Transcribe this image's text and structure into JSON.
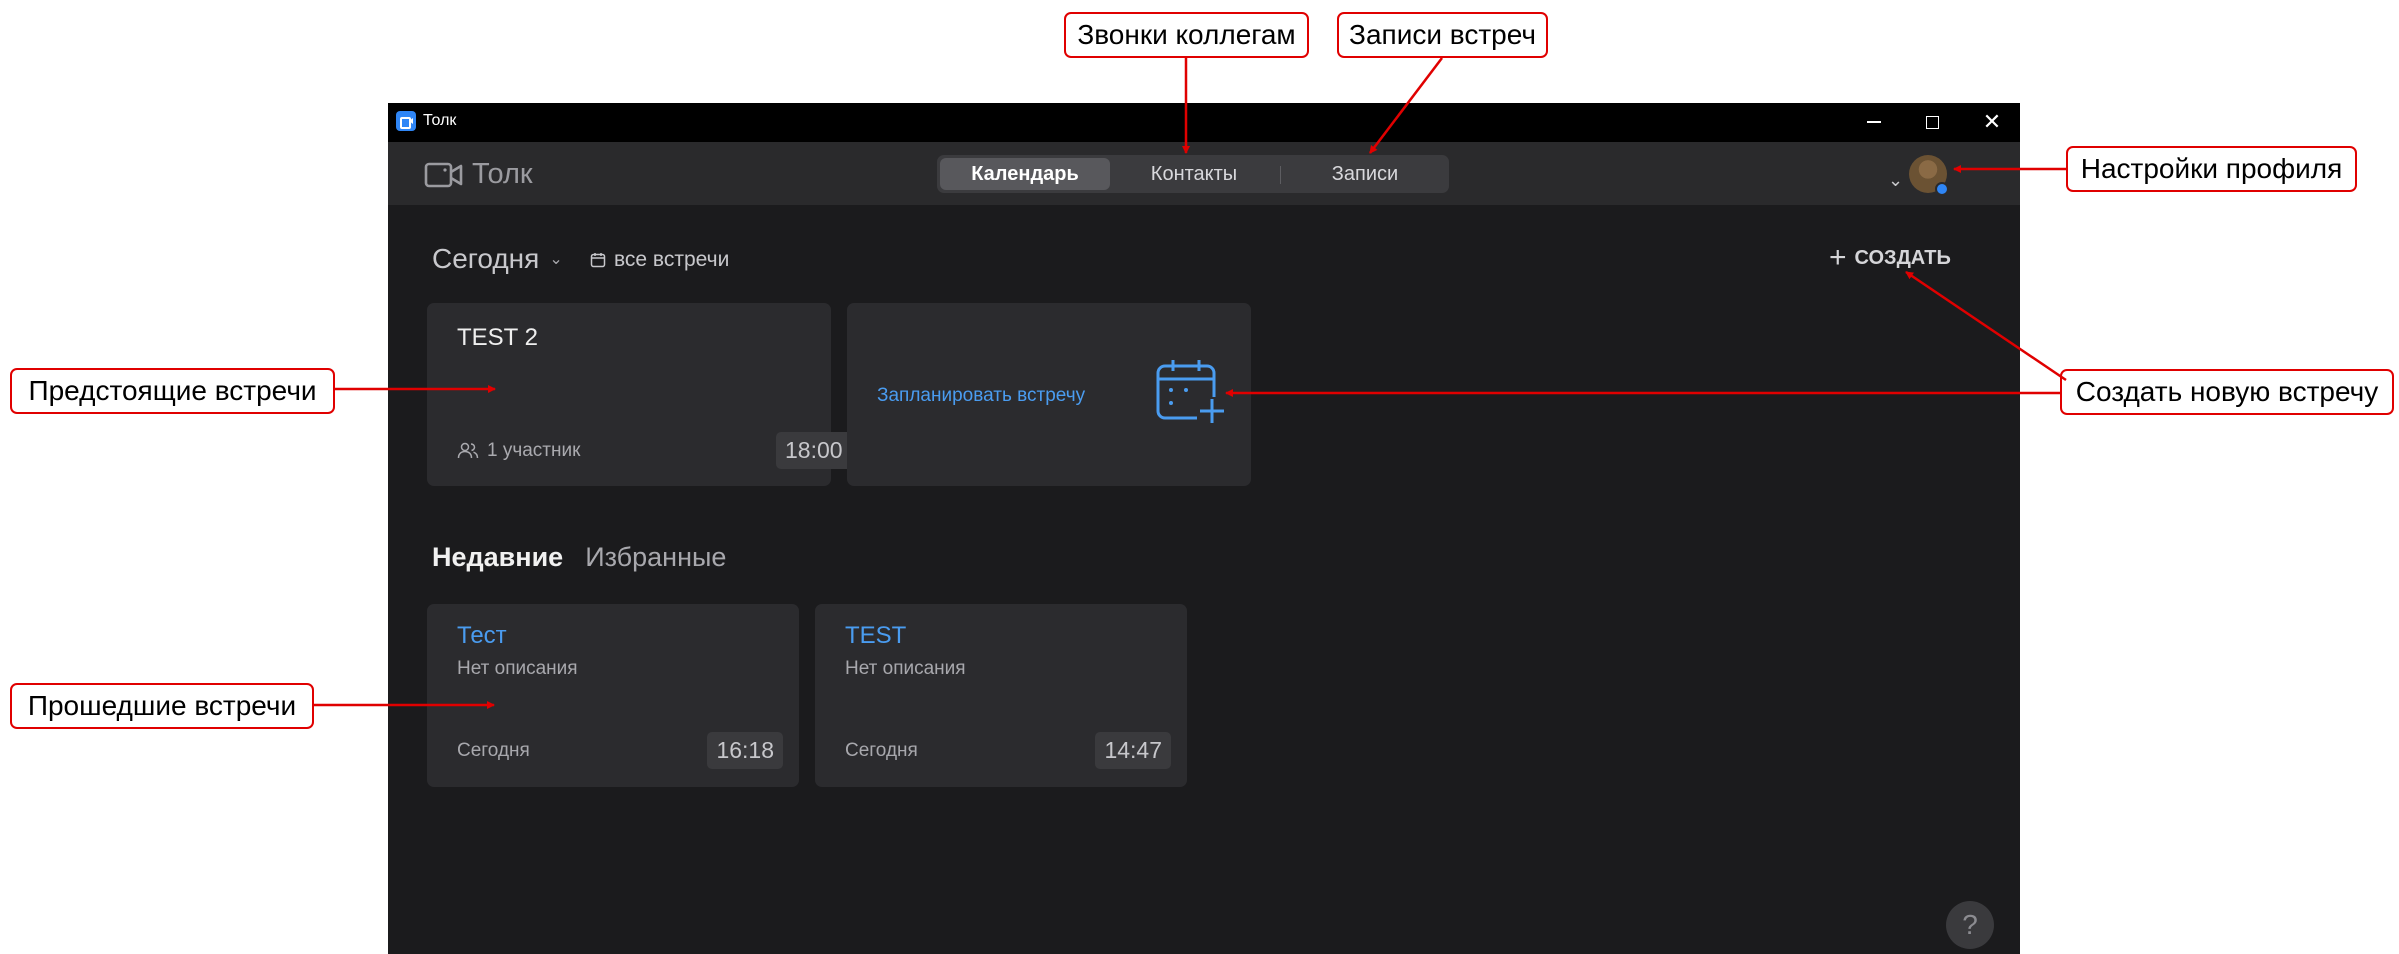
{
  "window": {
    "title": "Толк",
    "controls": {
      "minimize": "–",
      "maximize": "□",
      "close": "✕"
    }
  },
  "appbar": {
    "brand": "Толк",
    "nav": [
      {
        "label": "Календарь",
        "active": true
      },
      {
        "label": "Контакты",
        "active": false
      },
      {
        "label": "Записи",
        "active": false
      }
    ],
    "profile_icon": "avatar"
  },
  "toolbar": {
    "date_filter": "Сегодня",
    "all_meetings": "все встречи",
    "create_label": "СОЗДАТЬ"
  },
  "upcoming": {
    "title": "TEST 2",
    "participants": "1 участник",
    "time": "18:00"
  },
  "schedule": {
    "label": "Запланировать встречу",
    "icon": "calendar-add-icon"
  },
  "history_tabs": {
    "recent": "Недавние",
    "favorites": "Избранные"
  },
  "past_meetings": [
    {
      "name": "Тест",
      "description": "Нет описания",
      "day": "Сегодня",
      "time": "16:18"
    },
    {
      "name": "TEST",
      "description": "Нет описания",
      "day": "Сегодня",
      "time": "14:47"
    }
  ],
  "help": "?",
  "annotations": {
    "calls": "Звонки коллегам",
    "recordings": "Записи встреч",
    "profile": "Настройки профиля",
    "upcoming": "Предстоящие встречи",
    "create": "Создать новую встречу",
    "past": "Прошедшие встречи"
  },
  "colors": {
    "accent": "#4a9cf0",
    "annotation": "#e00000",
    "background": "#1b1b1d",
    "card": "#2b2b2e"
  }
}
